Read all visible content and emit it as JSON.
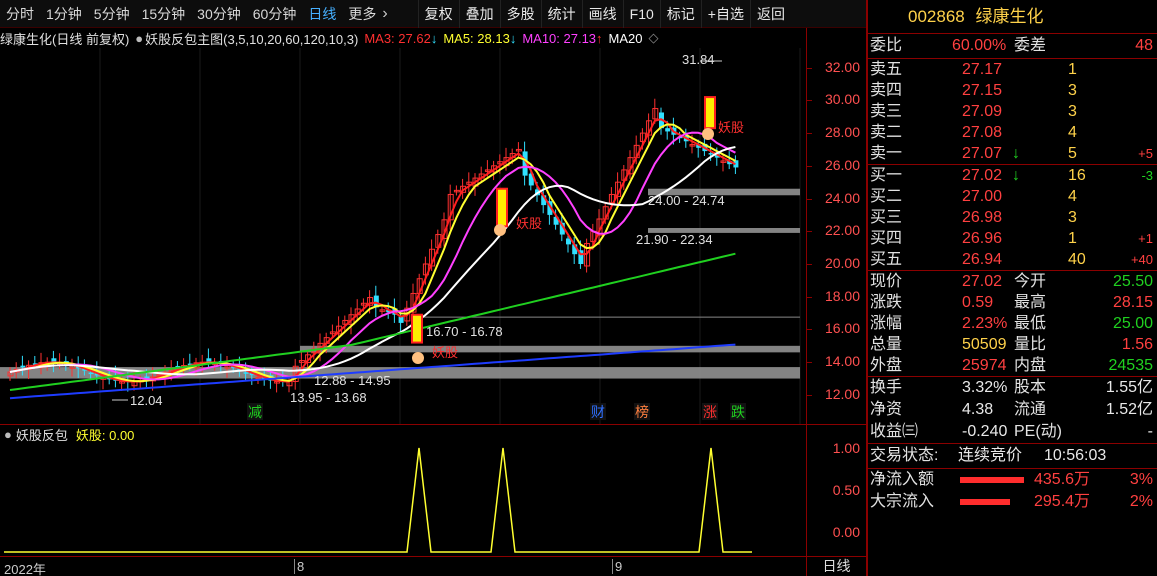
{
  "toolbar": {
    "periods": [
      "分时",
      "1分钟",
      "5分钟",
      "15分钟",
      "30分钟",
      "60分钟",
      "日线",
      "更多"
    ],
    "more_arrow": "›",
    "active_period": "日线",
    "buttons": [
      "复权",
      "叠加",
      "多股",
      "统计",
      "画线",
      "F10",
      "标记",
      "+自选",
      "返回"
    ]
  },
  "chart_info": {
    "title": "绿康生化(日线 前复权)",
    "indicator": "妖股反包主图(3,5,10,20,60,120,10,3)",
    "ma3": "MA3: 27.62",
    "ma5": "MA5: 28.13",
    "ma10": "MA10: 27.13",
    "ma20": "MA20",
    "down_arrow": "↓",
    "up_arrow": "↑"
  },
  "sub_info": {
    "title": "妖股反包",
    "value": "妖股: 0.00"
  },
  "colors": {
    "ma3": "#ff2020",
    "ma5": "#ffff30",
    "ma10": "#ff40ff",
    "ma20": "#ffffff",
    "ma60": "#20d020",
    "ma120": "#1e3cff",
    "up": "#ff3030",
    "down": "#30e0ff",
    "signal": "#ffff30"
  },
  "chart_data": {
    "type": "candlestick",
    "ylim": [
      11.2,
      33.2
    ],
    "yticks": [
      "32.00",
      "30.00",
      "28.00",
      "26.00",
      "24.00",
      "22.00",
      "20.00",
      "18.00",
      "16.00",
      "14.00",
      "12.00"
    ],
    "annotations": {
      "high": "31.84",
      "low": "12.04",
      "zone1": "12.88 - 14.95",
      "zone2": "13.95 - 13.68",
      "zone3": "16.70 - 16.78",
      "zone4": "24.00 - 24.74",
      "zone5": "21.90 - 22.34",
      "yaogu": "妖股"
    },
    "event_tags": [
      "减",
      "财",
      "榜",
      "涨",
      "跌"
    ],
    "sub_yticks": [
      "1.00",
      "0.50",
      "0.00"
    ],
    "dates": [
      "2022年",
      "8",
      "9"
    ]
  },
  "period_label": "日线",
  "quote": {
    "code": "002868",
    "name": "绿康生化",
    "weibi_label": "委比",
    "weibi": "60.00%",
    "weicha_label": "委差",
    "weicha": "48",
    "asks": [
      {
        "label": "卖五",
        "price": "27.17",
        "vol": "1",
        "chg": ""
      },
      {
        "label": "卖四",
        "price": "27.15",
        "vol": "3",
        "chg": ""
      },
      {
        "label": "卖三",
        "price": "27.09",
        "vol": "3",
        "chg": ""
      },
      {
        "label": "卖二",
        "price": "27.08",
        "vol": "4",
        "chg": ""
      },
      {
        "label": "卖一",
        "price": "27.07",
        "vol": "5",
        "chg": "+5"
      }
    ],
    "bids": [
      {
        "label": "买一",
        "price": "27.02",
        "vol": "16",
        "chg": "-3"
      },
      {
        "label": "买二",
        "price": "27.00",
        "vol": "4",
        "chg": ""
      },
      {
        "label": "买三",
        "price": "26.98",
        "vol": "3",
        "chg": ""
      },
      {
        "label": "买四",
        "price": "26.96",
        "vol": "1",
        "chg": "+1"
      },
      {
        "label": "买五",
        "price": "26.94",
        "vol": "40",
        "chg": "+40"
      }
    ],
    "stats": [
      {
        "l1": "现价",
        "v1": "27.02",
        "c1": "red",
        "l2": "今开",
        "v2": "25.50",
        "c2": "green"
      },
      {
        "l1": "涨跌",
        "v1": "0.59",
        "c1": "red",
        "l2": "最高",
        "v2": "28.15",
        "c2": "red"
      },
      {
        "l1": "涨幅",
        "v1": "2.23%",
        "c1": "red",
        "l2": "最低",
        "v2": "25.00",
        "c2": "green"
      },
      {
        "l1": "总量",
        "v1": "50509",
        "c1": "yellow",
        "l2": "量比",
        "v2": "1.56",
        "c2": "red"
      },
      {
        "l1": "外盘",
        "v1": "25974",
        "c1": "red",
        "l2": "内盘",
        "v2": "24535",
        "c2": "green"
      }
    ],
    "stats2": [
      {
        "l1": "换手",
        "v1": "3.32%",
        "l2": "股本",
        "v2": "1.55亿"
      },
      {
        "l1": "净资",
        "v1": "4.38",
        "l2": "流通",
        "v2": "1.52亿"
      },
      {
        "l1": "收益㈢",
        "v1": "-0.240",
        "l2": "PE(动)",
        "v2": "-"
      }
    ],
    "status_label": "交易状态:",
    "status": "连续竞价",
    "time": "10:56:03",
    "flows": [
      {
        "label": "净流入额",
        "value": "435.6万",
        "pct": "3%"
      },
      {
        "label": "大宗流入",
        "value": "295.4万",
        "pct": "2%"
      }
    ]
  }
}
